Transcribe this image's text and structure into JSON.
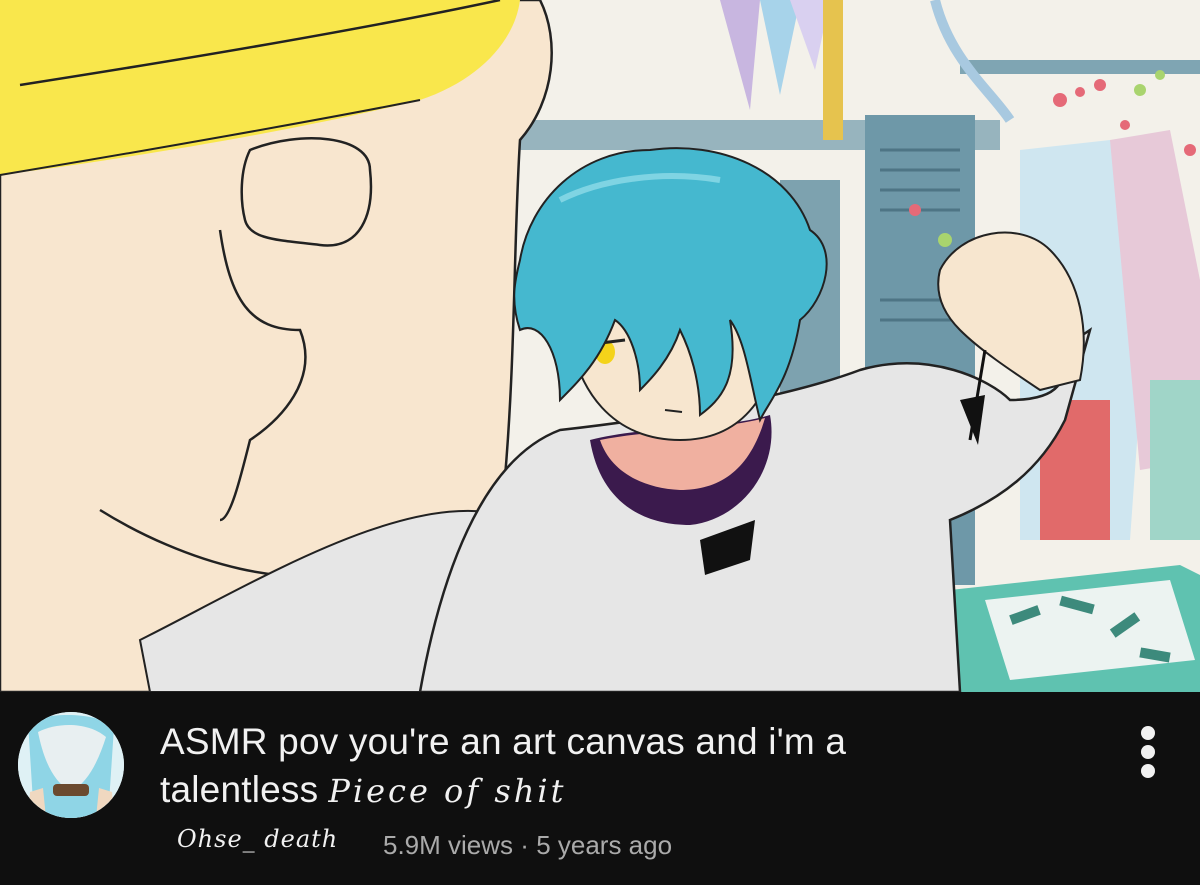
{
  "video": {
    "title_line1": "ASMR pov you're an art canvas and i'm a",
    "title_line2_typed": "talentless",
    "title_line2_handwritten": "Piece of shit",
    "channel_name": "Ohse_ death",
    "views": "5.9M views",
    "separator": "·",
    "age": "5 years ago"
  },
  "icons": {
    "menu": "more-vert-icon",
    "avatar": "channel-avatar"
  },
  "colors": {
    "background": "#0f0f0f",
    "title_text": "#f1f1f1",
    "meta_text": "#aaaaaa",
    "hair": "#45b8cf",
    "hood": "#e6e6e6",
    "skin": "#f7e6cf",
    "hat": "#f9e74c"
  }
}
